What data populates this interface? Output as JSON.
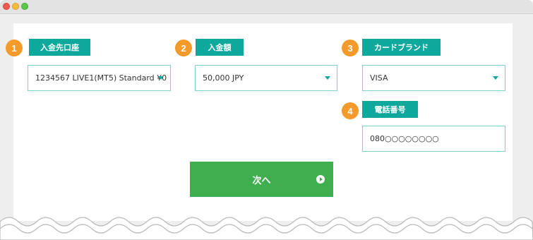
{
  "window": {
    "controls": [
      "close",
      "minimize",
      "maximize"
    ]
  },
  "steps": [
    {
      "number": "1",
      "label": "入金先口座",
      "value": "1234567 LIVE1(MT5) Standard ¥0",
      "type": "select"
    },
    {
      "number": "2",
      "label": "入金額",
      "value": "50,000 JPY",
      "type": "select"
    },
    {
      "number": "3",
      "label": "カードブランド",
      "value": "VISA",
      "type": "select"
    },
    {
      "number": "4",
      "label": "電話番号",
      "value": "080○○○○○○○○",
      "type": "input"
    }
  ],
  "next_button": {
    "label": "次へ",
    "icon": "arrow-right-circle-icon"
  },
  "colors": {
    "accent": "#0fa89c",
    "step_badge": "#f39a2b",
    "button": "#3fae4e",
    "field_border": "#7ed0c8"
  }
}
